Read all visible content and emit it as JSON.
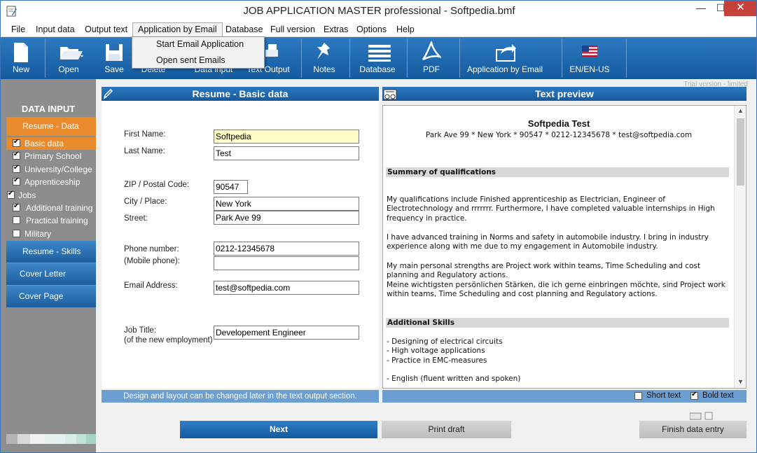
{
  "window": {
    "title": "JOB APPLICATION MASTER professional - Softpedia.bmf",
    "minimize": "—",
    "maximize": "☐",
    "close": "✕"
  },
  "menu": {
    "items": [
      "File",
      "Input data",
      "Output text",
      "Application by Email",
      "Database",
      "Full version",
      "Extras",
      "Options",
      "Help"
    ]
  },
  "toolbar": {
    "buttons": [
      "New",
      "Open",
      "Save",
      "Delete",
      "Data input",
      "Text Output",
      "Notes",
      "Database",
      "PDF",
      "Application by Email",
      "EN/EN-US"
    ]
  },
  "dropdown": {
    "items": [
      "Start Email Application",
      "Open sent Emails"
    ]
  },
  "sidebar": {
    "title": "DATA INPUT",
    "sections": [
      "Resume - Data",
      "Resume - Skills",
      "Cover Letter",
      "Cover Page"
    ],
    "checks": [
      {
        "label": "Basic data",
        "checked": true
      },
      {
        "label": "Primary School",
        "checked": true
      },
      {
        "label": "University/College",
        "checked": true
      },
      {
        "label": "Apprenticeship",
        "checked": true
      },
      {
        "label": "Jobs",
        "checked": true
      },
      {
        "label": "Additional training",
        "checked": true
      },
      {
        "label": "Practical training",
        "checked": false
      },
      {
        "label": "Military",
        "checked": false
      }
    ],
    "swatch_colors": [
      "#b3b3b3",
      "#d9d9d9",
      "#f2f2f2",
      "#e6f2f2",
      "#d6ece6",
      "#bfe3d6",
      "#a6d6c3"
    ]
  },
  "main": {
    "trial_notice": "Trial version - limited",
    "form_header": "Resume - Basic data",
    "preview_header": "Text preview",
    "info_text": "Design and layout can be changed later in the text output section.",
    "fields": {
      "first_name_label": "First Name:",
      "first_name": "Softpedia",
      "last_name_label": "Last Name:",
      "last_name": "Test",
      "zip_label": "ZIP / Postal Code:",
      "zip": "90547",
      "city_label": "City / Place:",
      "city": "New York",
      "street_label": "Street:",
      "street": "Park Ave 99",
      "phone_label": "Phone number:",
      "phone": "0212-12345678",
      "mobile_label": "(Mobile phone):",
      "mobile": "",
      "email_label": "Email Address:",
      "email": "test@softpedia.com",
      "job_title_label": "Job Title:",
      "job_title_sub": "(of the new employment)",
      "job_title": "Developement Engineer"
    },
    "preview": {
      "name": "Softpedia Test",
      "address": "Park Ave 99 * New York * 90547 * 0212-12345678 * test@softpedia.com",
      "section1": "Summary of qualifications",
      "p1a": "My qualifications include Finished apprenticeship as Electrician, Engineer of",
      "p1b": "Electrotechnology  and rrrrrrr. Furthermore, I have completed valuable internships in High",
      "p1c": "frequency in practice.",
      "p2a": "I have advanced training in Norms and safety in automobile industry. I bring in industry",
      "p2b": "experience along with me due to my engagement in Automobile industry.",
      "p3a": "My main personal strengths are Project work within teams, Time Scheduling and cost",
      "p3b": "planning and Regulatory actions.",
      "p3c": "Meine wichtigsten persönlichen Stärken, die ich gerne einbringen möchte, sind Project work",
      "p3d": "within teams, Time Scheduling and cost planning and Regulatory actions.",
      "section2": "Additional Skills",
      "s1": "- Designing of electrical circuits",
      "s2": "- High voltage applications",
      "s3": "- Practice in EMC-measures",
      "s4": "- English (fluent written and spoken)"
    },
    "options": {
      "short_text": "Short text",
      "short_checked": false,
      "bold_text": "Bold text",
      "bold_checked": true
    },
    "buttons": {
      "next": "Next",
      "print": "Print draft",
      "finish": "Finish data entry"
    }
  }
}
